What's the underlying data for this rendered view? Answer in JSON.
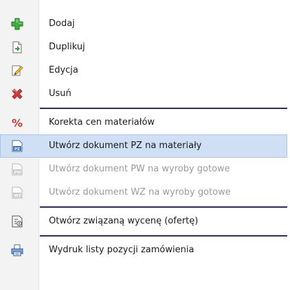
{
  "menu": {
    "items": [
      {
        "label": "Dodaj",
        "icon": "plus-green-icon",
        "enabled": true
      },
      {
        "label": "Duplikuj",
        "icon": "duplicate-page-icon",
        "enabled": true
      },
      {
        "label": "Edycja",
        "icon": "edit-pencil-icon",
        "enabled": true
      },
      {
        "label": "Usuń",
        "icon": "delete-x-icon",
        "enabled": true
      },
      {
        "label": "Korekta cen materiałów",
        "icon": "percent-icon",
        "enabled": true
      },
      {
        "label": "Utwórz dokument PZ na materiały",
        "icon": "document-pz-icon",
        "enabled": true,
        "highlighted": true
      },
      {
        "label": "Utwórz dokument PW na wyroby gotowe",
        "icon": "document-pw-icon",
        "enabled": false
      },
      {
        "label": "Utwórz dokument WZ na wyroby gotowe",
        "icon": "document-wz-icon",
        "enabled": false
      },
      {
        "label": "Otwórz związaną wycenę (ofertę)",
        "icon": "quote-document-icon",
        "enabled": true
      },
      {
        "label": "Wydruk listy pozycji zamówienia",
        "icon": "printer-icon",
        "enabled": true
      }
    ],
    "icon_text": {
      "pz": "PZ",
      "pw": "PW",
      "wz": "WZ",
      "percent": "%"
    },
    "colors": {
      "highlight": "#cfe0f5",
      "highlight_border": "#a9c4e8",
      "separator": "#2a2a64",
      "disabled_text": "#9a9a9a"
    }
  }
}
